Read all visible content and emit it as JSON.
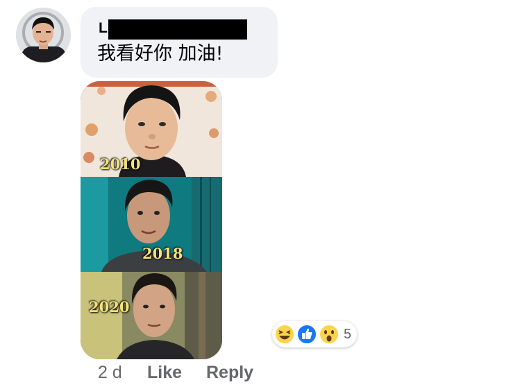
{
  "comment": {
    "author_initial": "L",
    "text": "我看好你 加油!",
    "time": "2 d",
    "like_label": "Like",
    "reply_label": "Reply"
  },
  "attachment": {
    "years": [
      "2010",
      "2018",
      "2020"
    ]
  },
  "reactions": {
    "icons": [
      "laugh-reaction-icon",
      "like-reaction-icon",
      "wow-reaction-icon"
    ],
    "count": "5"
  },
  "colors": {
    "like_blue": "#1877f2",
    "reaction_yellow": "#fcd34d",
    "bubble_bg": "#f0f2f5",
    "secondary_text": "#65676b"
  }
}
